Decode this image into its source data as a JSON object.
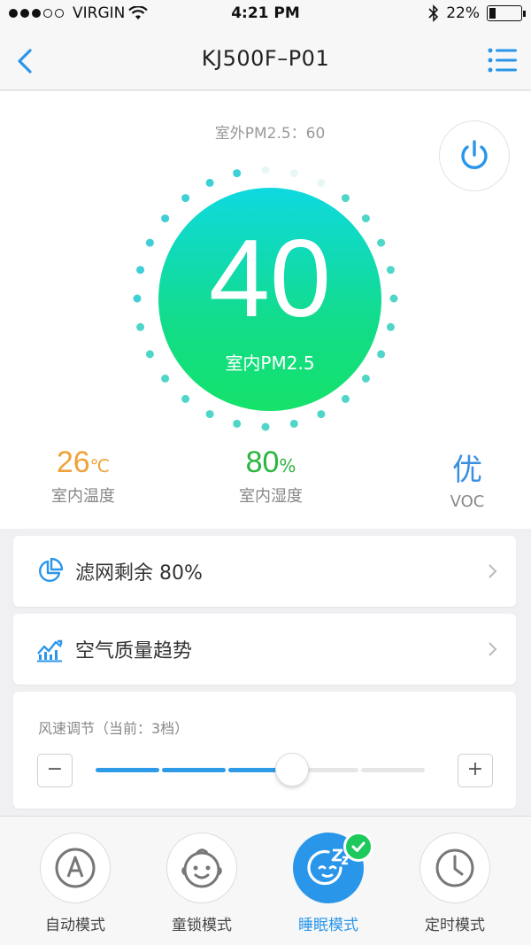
{
  "status_bar": {
    "carrier": "VIRGIN",
    "time": "4:21 PM",
    "battery": "22%",
    "battery_level": 0.22,
    "signal_bars_filled": 3,
    "signal_bars_total": 5
  },
  "nav": {
    "title": "KJ500F–P01",
    "back_icon": "chevron-left-icon",
    "menu_icon": "list-menu-icon"
  },
  "air": {
    "outdoor_text": "室外PM2.5：60",
    "indoor_pm_value": "40",
    "indoor_pm_label": "室内PM2.5"
  },
  "metrics": [
    {
      "value": "26",
      "unit": "℃",
      "label": "室内温度",
      "color": "#f0a23a"
    },
    {
      "value": "80",
      "unit": "%",
      "label": "室内湿度",
      "color": "#29b53e"
    },
    {
      "value": "优",
      "unit": "",
      "label": "VOC",
      "color": "#3a8fe0"
    }
  ],
  "cards": {
    "filter_label": "滤网剩余 80%",
    "trend_label": "空气质量趋势"
  },
  "wind": {
    "title": "风速调节（当前：3档）",
    "minus": "−",
    "plus": "+",
    "level": 3,
    "levels": 5
  },
  "modes": [
    {
      "label": "自动模式",
      "icon": "auto-mode-icon",
      "active": false
    },
    {
      "label": "童锁模式",
      "icon": "child-lock-icon",
      "active": false
    },
    {
      "label": "睡眠模式",
      "icon": "sleep-mode-icon",
      "active": true
    },
    {
      "label": "定时模式",
      "icon": "timer-icon",
      "active": false
    }
  ],
  "colors": {
    "accent": "#2a96ea",
    "pm_gradient_top": "#0fd9e0",
    "pm_gradient_bottom": "#14e26a",
    "check": "#1dc95c"
  }
}
